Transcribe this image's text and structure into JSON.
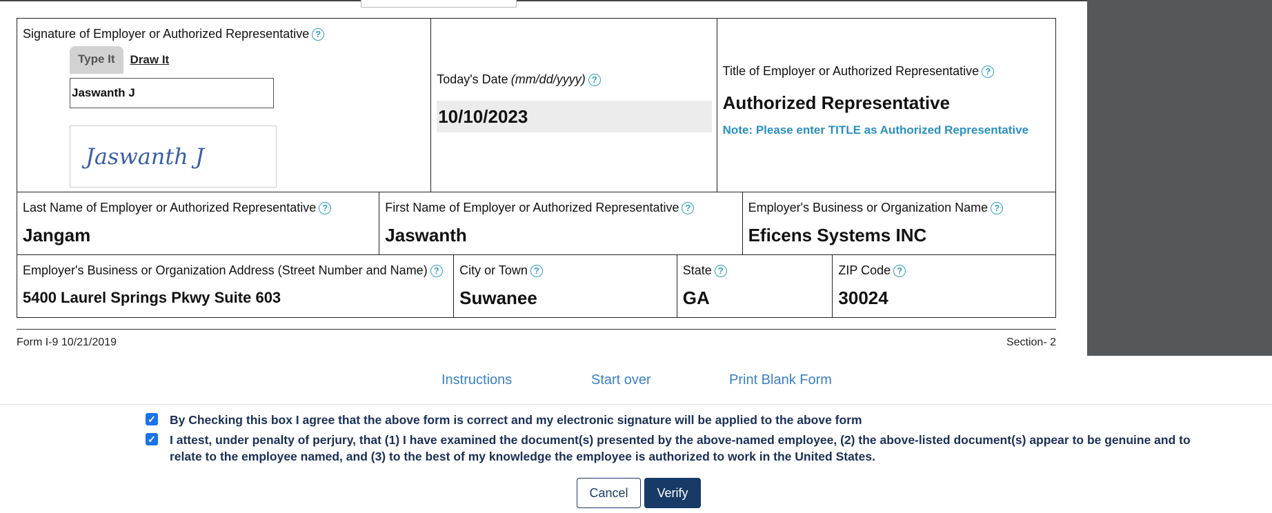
{
  "sig_cell": {
    "label": "Signature of Employer or Authorized Representative",
    "tab_type": "Type It",
    "tab_draw": "Draw It",
    "typed_name": "Jaswanth J",
    "rendered_signature": "Jaswanth J"
  },
  "date_cell": {
    "label": "Today's Date",
    "format_hint": "(mm/dd/yyyy)",
    "value": "10/10/2023"
  },
  "title_cell": {
    "label": "Title of Employer or Authorized Representative",
    "value": "Authorized Representative",
    "note": "Note: Please enter TITLE as Authorized Representative"
  },
  "last_name": {
    "label": "Last Name of Employer or Authorized Representative",
    "value": "Jangam"
  },
  "first_name": {
    "label": "First Name of Employer or Authorized Representative",
    "value": "Jaswanth"
  },
  "business_name": {
    "label": "Employer's Business or Organization Name",
    "value": "Eficens Systems INC"
  },
  "address": {
    "label": "Employer's Business or Organization Address (Street Number and Name)",
    "value": "5400 Laurel Springs Pkwy Suite 603"
  },
  "city": {
    "label": "City or Town",
    "value": "Suwanee"
  },
  "state": {
    "label": "State",
    "value": "GA"
  },
  "zip": {
    "label": "ZIP Code",
    "value": "30024"
  },
  "help_glyph": "?",
  "footer": {
    "form_id": "Form I-9 10/21/2019",
    "section": "Section- 2"
  },
  "links": {
    "instructions": "Instructions",
    "start_over": "Start over",
    "print_blank": "Print Blank Form"
  },
  "agreements": {
    "checkmark": "✓",
    "agree_text": "By Checking this box I agree that the above form is correct and my electronic signature will be applied to the above form",
    "attest_text": "I attest, under penalty of perjury, that (1) I have examined the document(s) presented by the above-named employee, (2) the above-listed document(s) appear to be genuine and to relate to the employee named, and (3) to the best of my knowledge the employee is authorized to work in the United States."
  },
  "buttons": {
    "cancel": "Cancel",
    "verify": "Verify"
  },
  "colors": {
    "accent": "#2e9cc8",
    "primary_button": "#173a66",
    "checkbox": "#1a73e8",
    "side_panel": "#55585b"
  }
}
